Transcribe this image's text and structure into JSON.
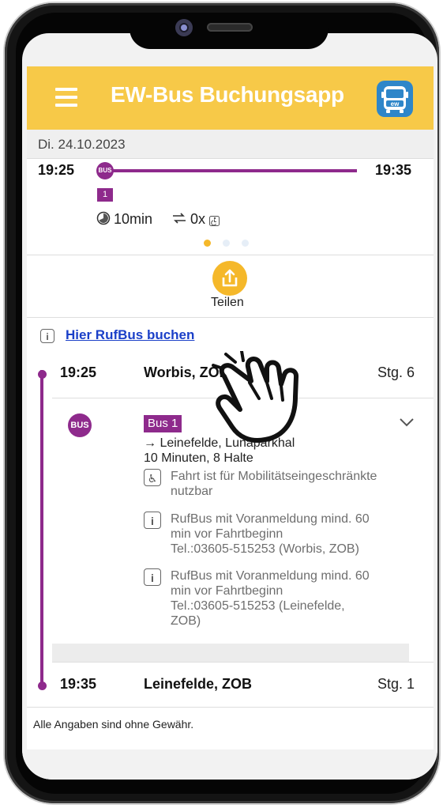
{
  "header": {
    "title": "EW-Bus Buchungsapp",
    "logo_text": "ew",
    "brand_color": "#f7c948"
  },
  "trip": {
    "date": "Di. 24.10.2023",
    "departure_time": "19:25",
    "arrival_time": "19:35",
    "bus_icon_text": "BUS",
    "line_number": "1",
    "duration": "10min",
    "transfers": "0x",
    "line_color": "#8e2a8c"
  },
  "share": {
    "label": "Teilen"
  },
  "rufbus_link": "Hier RufBus buchen",
  "stops": {
    "origin": {
      "time": "19:25",
      "name": "Worbis, ZOB",
      "platform": "Stg. 6"
    },
    "destination": {
      "time": "19:35",
      "name": "Leinefelde, ZOB",
      "platform": "Stg. 1"
    }
  },
  "leg": {
    "mode_icon_text": "BUS",
    "line_label": "Bus 1",
    "direction": "→ Leinefelde, Lunaparkhal",
    "summary": "10 Minuten, 8 Halte",
    "accessibility_line1": "Fahrt ist für Mobilitätseingeschränkte",
    "accessibility_line2": "nutzbar",
    "note1_line1": "RufBus mit Voranmeldung mind. 60",
    "note1_line2": "min vor Fahrtbeginn",
    "note1_line3": "Tel.:03605-515253 (Worbis, ZOB)",
    "note2_line1": "RufBus mit Voranmeldung mind. 60",
    "note2_line2": "min vor Fahrtbeginn",
    "note2_line3": "Tel.:03605-515253 (Leinefelde,",
    "note2_line4": "ZOB)"
  },
  "disclaimer": "Alle Angaben sind ohne Gewähr."
}
